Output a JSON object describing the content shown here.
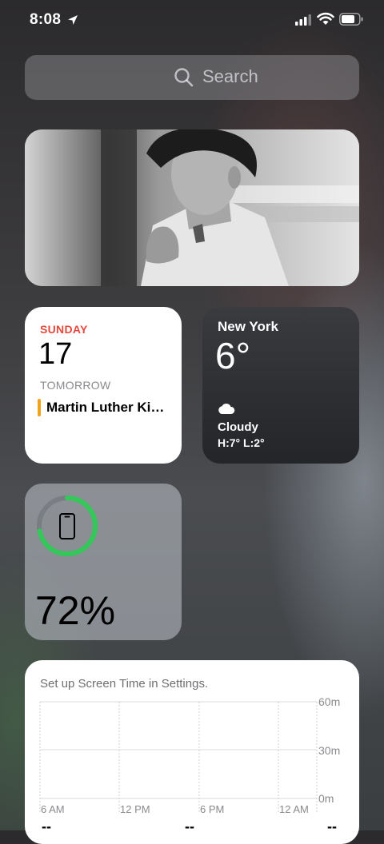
{
  "status_bar": {
    "time": "8:08"
  },
  "search": {
    "placeholder": "Search"
  },
  "calendar": {
    "day": "SUNDAY",
    "date": "17",
    "section": "TOMORROW",
    "event": "Martin Luther Ki…"
  },
  "weather": {
    "city": "New York",
    "temp": "6°",
    "condition": "Cloudy",
    "high_low": "H:7° L:2°"
  },
  "battery_widget": {
    "percent_label": "72%",
    "level": 0.72
  },
  "screen_time": {
    "message": "Set up Screen Time in Settings.",
    "y_labels": [
      "60m",
      "30m",
      "0m"
    ],
    "x_labels": [
      "6 AM",
      "12 PM",
      "6 PM",
      "12 AM"
    ],
    "footer": [
      "--",
      "--",
      "--"
    ]
  },
  "colors": {
    "calendar_accent": "#e5483c",
    "event_bar": "#f0a21a",
    "battery_ring": "#34c759"
  }
}
